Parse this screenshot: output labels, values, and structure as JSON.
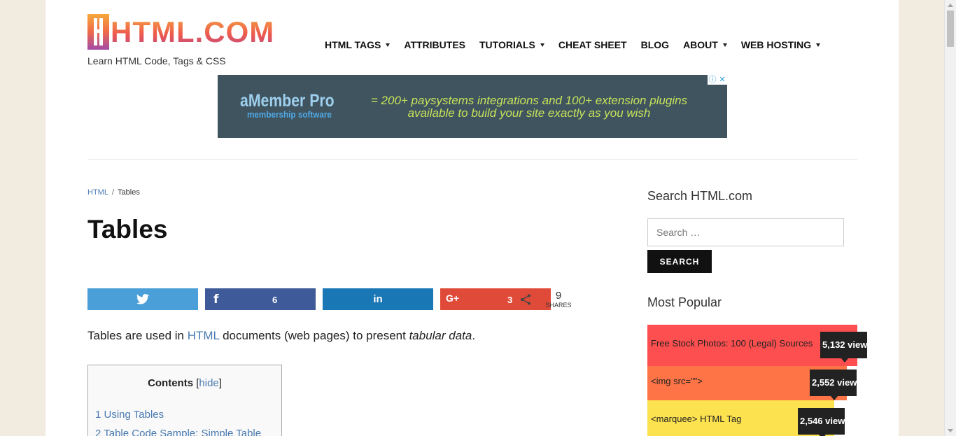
{
  "site": {
    "logo_text": "HTML.COM",
    "tagline": "Learn HTML Code, Tags & CSS"
  },
  "nav": {
    "items": [
      {
        "label": "HTML TAGS",
        "dropdown": true
      },
      {
        "label": "ATTRIBUTES",
        "dropdown": false
      },
      {
        "label": "TUTORIALS",
        "dropdown": true
      },
      {
        "label": "CHEAT SHEET",
        "dropdown": false
      },
      {
        "label": "BLOG",
        "dropdown": false
      },
      {
        "label": "ABOUT",
        "dropdown": true
      },
      {
        "label": "WEB HOSTING",
        "dropdown": true
      }
    ]
  },
  "ad": {
    "brand": "aMember Pro",
    "subbrand": "membership software",
    "copy_line1": "= 200+ paysystems integrations and 100+ extension plugins",
    "copy_line2": "available to build your site exactly as you wish",
    "info_icon": "ⓘ",
    "close_icon": "✕"
  },
  "breadcrumb": {
    "root": "HTML",
    "separator": "/",
    "current": "Tables"
  },
  "article": {
    "title": "Tables",
    "intro_before": "Tables are used in ",
    "intro_link": "HTML",
    "intro_middle": " documents (web pages) to present ",
    "intro_em": "tabular data",
    "intro_end": "."
  },
  "share": {
    "twitter_count": "",
    "facebook_count": "6",
    "linkedin_count": "",
    "googleplus_count": "3",
    "total": "9",
    "total_label": "SHARES",
    "icons": {
      "twitter": "twitter-icon",
      "facebook": "facebook-icon",
      "linkedin": "linkedin-icon",
      "googleplus": "googleplus-icon",
      "share": "share-icon"
    },
    "colors": {
      "twitter": "#4b9fd8",
      "facebook": "#3f5a99",
      "linkedin": "#1a77b5",
      "googleplus": "#e04b39"
    }
  },
  "toc": {
    "title": "Contents",
    "toggle_open": "[",
    "toggle_link": "hide",
    "toggle_close": "]",
    "items": [
      "1 Using Tables",
      "2 Table Code Sample: Simple Table"
    ]
  },
  "sidebar": {
    "search_heading": "Search HTML.com",
    "search_placeholder": "Search …",
    "search_button": "SEARCH",
    "popular_heading": "Most Popular",
    "popular": [
      {
        "title": "Free Stock Photos: 100 (Legal) Sources",
        "views": "5,132 view",
        "color": "#fd4f4f",
        "fill": 1.0
      },
      {
        "title": "<img src=\"\">",
        "views": "2,552 view",
        "color": "#fe7446",
        "fill": 0.95
      },
      {
        "title": "<marquee> HTML Tag",
        "views": "2,546 view",
        "color": "#fde24f",
        "fill": 0.89
      }
    ]
  }
}
